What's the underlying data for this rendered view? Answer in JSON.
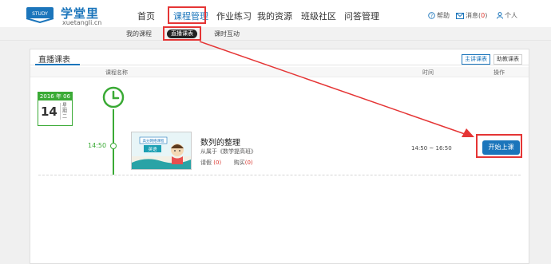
{
  "brand": {
    "name": "学堂里",
    "domain": "xuetangli.cn",
    "badge": "STUDY"
  },
  "nav": {
    "items": [
      "首页",
      "课程管理",
      "作业练习",
      "我的资源",
      "班级社区",
      "问答管理"
    ],
    "active_index": 1
  },
  "tools": {
    "help": "帮助",
    "messages_label": "消息",
    "messages_count": "0",
    "profile": "个人"
  },
  "subnav": {
    "items": [
      "我的课程",
      "直播课表",
      "课时互动"
    ],
    "active_index": 1
  },
  "card": {
    "title": "直播课表",
    "tabs": [
      "主讲课表",
      "助教课表"
    ],
    "active_tab": 0,
    "columns": {
      "name": "课程名称",
      "time": "时间",
      "action": "操作"
    }
  },
  "date": {
    "header": "2016 年 06月",
    "day": "14",
    "week": "星期二"
  },
  "lesson": {
    "clock_time": "14:50",
    "thumb_banner": "高分网络课程",
    "thumb_subject": "英语",
    "title": "数列的整理",
    "from_prefix": "从属于",
    "from_course": "《数学提高班》",
    "leave_label": "请假",
    "leave_count": "(0)",
    "buy_label": "购买",
    "buy_count": "(0)",
    "time_range": "14:50 ~ 16:50",
    "action": "开始上课"
  },
  "colors": {
    "accent": "#1b75bb",
    "green": "#3aaa35",
    "annotation": "#e53535"
  }
}
